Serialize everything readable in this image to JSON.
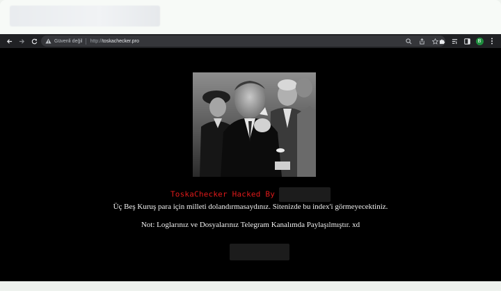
{
  "browser": {
    "security_label": "Güvenli değil",
    "url_protocol": "http://",
    "url_host": "toskachecker.pro",
    "profile_initial": "B"
  },
  "page": {
    "headline": "ToskaChecker Hacked By",
    "message_line1": "Üç Beş Kuruş para için milleti dolandırmasaydınız. Sitenizde bu index'i görmeyecektiniz.",
    "message_line2": "Not: Loglarınız ve Dosyalarınız Telegram Kanalımda Paylaşılmıştır. xd"
  },
  "colors": {
    "headline": "#e01a1a",
    "text": "#f2f2f2",
    "page_background": "#000000",
    "toolbar": "#202124",
    "profile": "#1e8e3e"
  }
}
